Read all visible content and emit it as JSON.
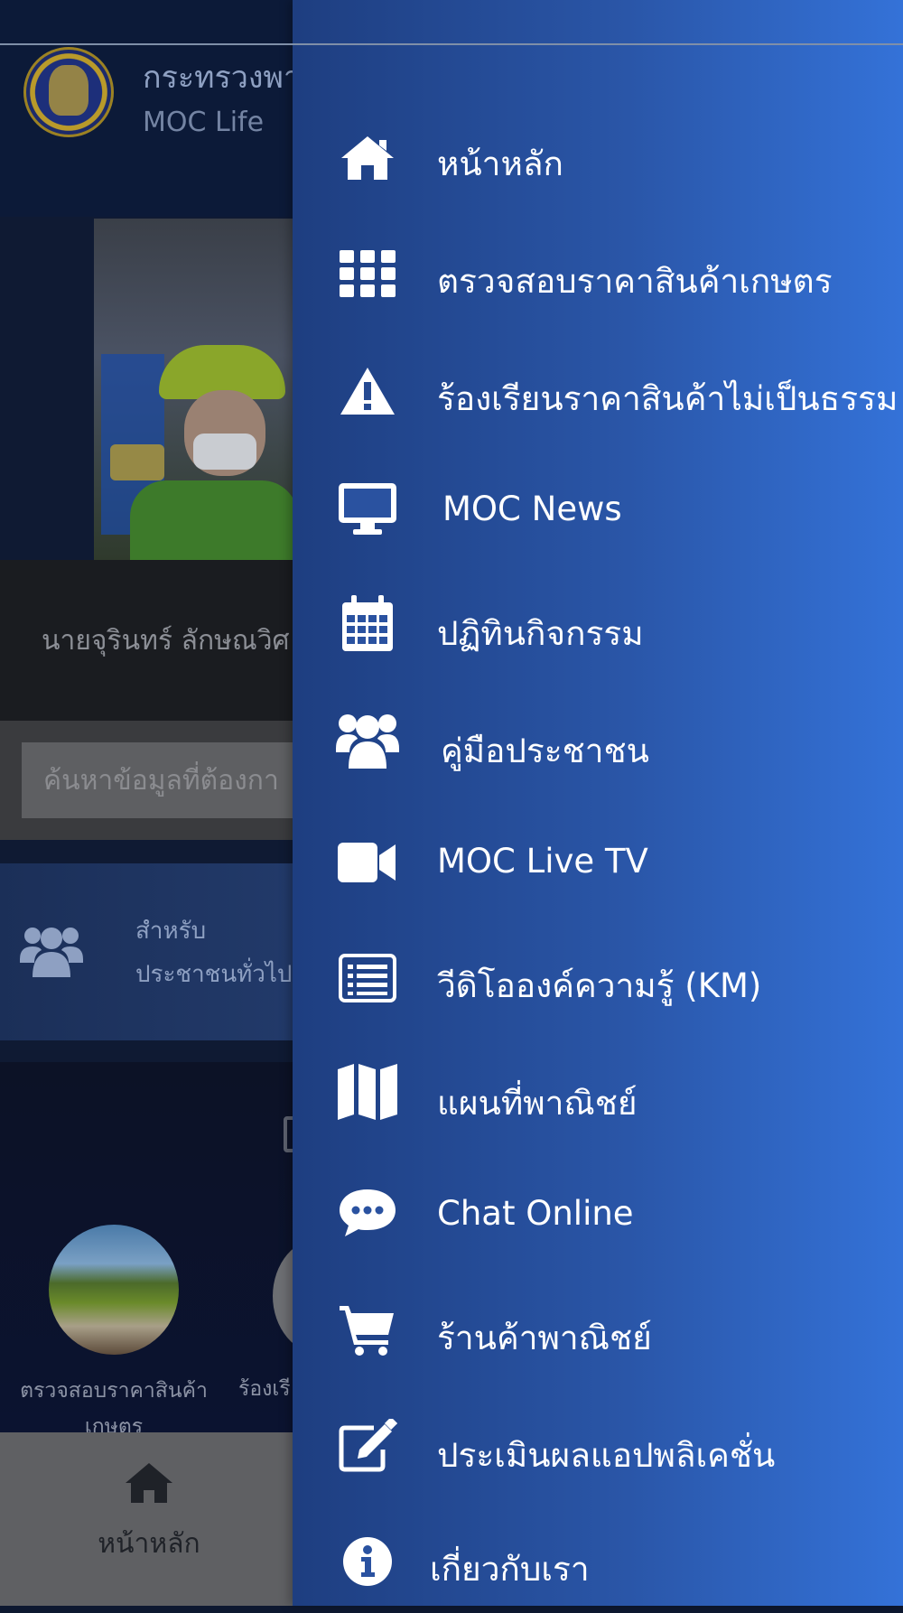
{
  "app": {
    "title": "กระทรวงพา",
    "subtitle": "MOC Life",
    "news_caption": "นายจุรินทร์ ลักษณวิศ",
    "search": {
      "placeholder": "ค้นหาข้อมูลที่ต้องกา"
    },
    "public_section": {
      "line1": "สำหรับ",
      "line2": "ประชาชนทั่วไป",
      "icon": "users-icon"
    },
    "categories": [
      {
        "label": "ตรวจสอบราคาสินค้าเกษตร"
      },
      {
        "label": "ร้องเรี"
      }
    ],
    "bottom_nav": {
      "home_label": "หน้าหลัก",
      "home_icon": "home-icon"
    }
  },
  "drawer": {
    "items": [
      {
        "label": "หน้าหลัก",
        "icon": "home-icon"
      },
      {
        "label": "ตรวจสอบราคาสินค้าเกษตร",
        "icon": "grid-icon"
      },
      {
        "label": "ร้องเรียนราคาสินค้าไม่เป็นธรรม",
        "icon": "warning-icon"
      },
      {
        "label": "MOC News",
        "icon": "monitor-icon"
      },
      {
        "label": "ปฏิทินกิจกรรม",
        "icon": "calendar-icon"
      },
      {
        "label": "คู่มือประชาชน",
        "icon": "users-icon"
      },
      {
        "label": "MOC Live TV",
        "icon": "video-camera-icon"
      },
      {
        "label": "วีดิโอองค์ความรู้ (KM)",
        "icon": "list-icon"
      },
      {
        "label": "แผนที่พาณิชย์",
        "icon": "map-icon"
      },
      {
        "label": "Chat Online",
        "icon": "chat-icon"
      },
      {
        "label": "ร้านค้าพาณิชย์",
        "icon": "cart-icon"
      },
      {
        "label": "ประเมินผลแอปพลิเคชั่น",
        "icon": "edit-icon"
      },
      {
        "label": "เกี่ยวกับเรา",
        "icon": "info-icon"
      }
    ]
  },
  "colors": {
    "drawer_start": "#1e3e80",
    "drawer_end": "#3472d8",
    "overlay": "#0f1a33"
  }
}
